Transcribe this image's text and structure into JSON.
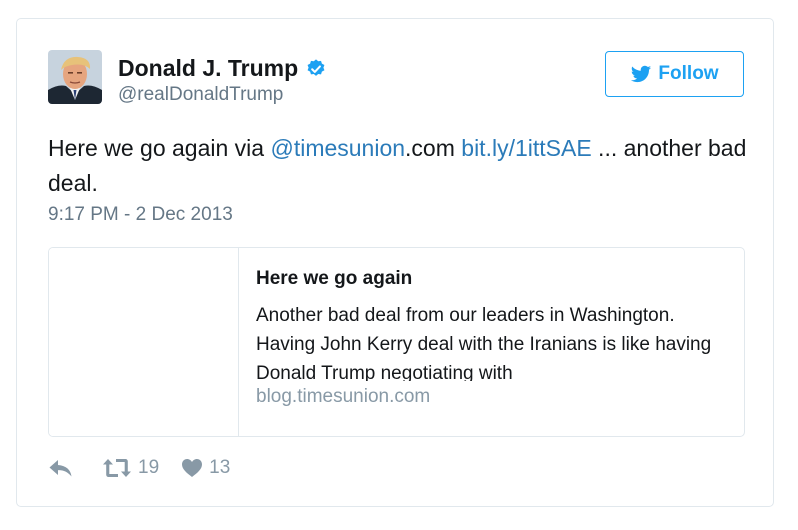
{
  "author": {
    "name": "Donald J. Trump",
    "handle": "@realDonaldTrump"
  },
  "follow_button": {
    "label": "Follow"
  },
  "tweet": {
    "text_before": "Here we go again via ",
    "mention": "@timesunion",
    "text_mid": ".com ",
    "link": "bit.ly/1ittSAE",
    "text_after": " ... another bad deal.",
    "timestamp": "9:17 PM - 2 Dec 2013"
  },
  "link_preview": {
    "title": "Here we go again",
    "description": "Another bad deal from our leaders in Washington. Having John Kerry deal with the Iranians is like having Donald Trump negotiating with",
    "domain": "blog.timesunion.com"
  },
  "actions": {
    "retweet_count": "19",
    "like_count": "13"
  },
  "colors": {
    "accent": "#1da1f2",
    "link": "#2b7bb9",
    "muted": "#657786",
    "border": "#e1e8ed"
  }
}
